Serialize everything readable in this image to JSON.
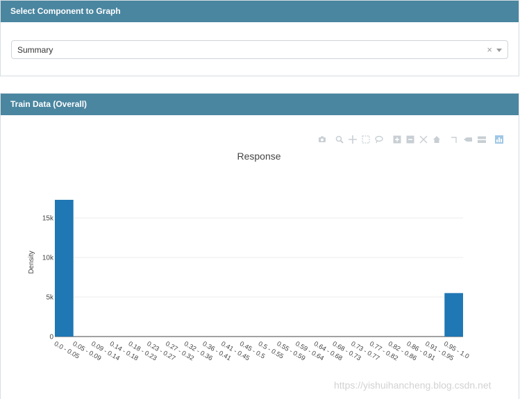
{
  "panel1": {
    "title": "Select Component to Graph"
  },
  "select": {
    "value": "Summary",
    "clear": "×"
  },
  "panel2": {
    "title": "Train Data (Overall)"
  },
  "modebar": {
    "icons": [
      "camera-icon",
      "zoom-icon",
      "pan-icon",
      "box-select-icon",
      "lasso-icon",
      "zoom-in-icon",
      "zoom-out-icon",
      "autoscale-icon",
      "reset-axes-icon",
      "spike-lines-icon",
      "hover-closest-icon",
      "hover-compare-icon",
      "plotly-logo-icon"
    ]
  },
  "watermark": "https://yishuihancheng.blog.csdn.net",
  "chart_data": {
    "type": "bar",
    "title": "Response",
    "ylabel": "Density",
    "xlabel": "",
    "color": "#1f77b4",
    "ylim": [
      0,
      18000
    ],
    "yticks": [
      0,
      5000,
      10000,
      15000
    ],
    "ytick_labels": [
      "0",
      "5k",
      "10k",
      "15k"
    ],
    "categories": [
      "0.0 - 0.05",
      "0.05 - 0.09",
      "0.09 - 0.14",
      "0.14 - 0.18",
      "0.18 - 0.23",
      "0.23 - 0.27",
      "0.27 - 0.32",
      "0.32 - 0.36",
      "0.36 - 0.41",
      "0.41 - 0.45",
      "0.45 - 0.5",
      "0.5 - 0.55",
      "0.55 - 0.59",
      "0.59 - 0.64",
      "0.64 - 0.68",
      "0.68 - 0.73",
      "0.73 - 0.77",
      "0.77 - 0.82",
      "0.82 - 0.86",
      "0.86 - 0.91",
      "0.91 - 0.95",
      "0.95 - 1.0"
    ],
    "values": [
      17300,
      0,
      0,
      0,
      0,
      0,
      0,
      0,
      0,
      0,
      0,
      0,
      0,
      0,
      0,
      0,
      0,
      0,
      0,
      0,
      0,
      5500
    ]
  }
}
